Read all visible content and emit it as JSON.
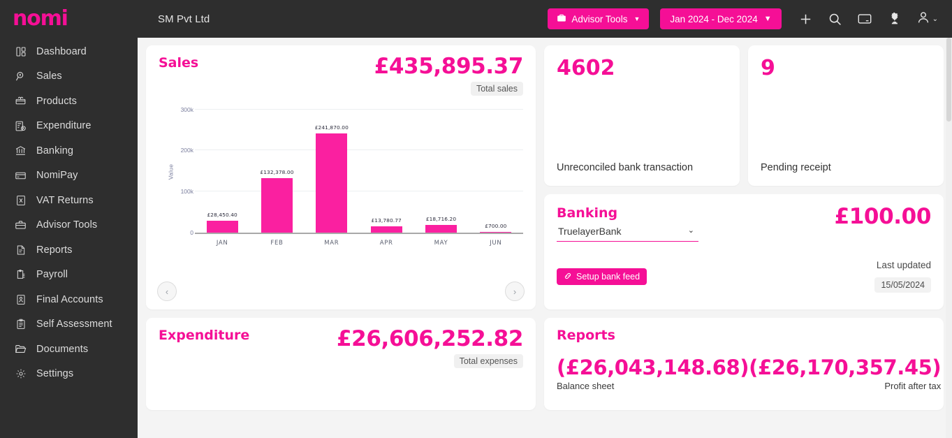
{
  "brand": {
    "logo_text": "nomi",
    "accent": "#f50f96",
    "dark": "#2e2e2e"
  },
  "header": {
    "company_name": "SM Pvt Ltd",
    "advisor_tools_label": "Advisor Tools",
    "date_range_label": "Jan 2024 - Dec 2024",
    "icons": [
      "plus-icon",
      "search-icon",
      "card-icon",
      "hmrc-crest-icon",
      "user-icon"
    ]
  },
  "sidebar": {
    "items": [
      {
        "label": "Dashboard",
        "icon": "dashboard-icon"
      },
      {
        "label": "Sales",
        "icon": "sales-icon"
      },
      {
        "label": "Products",
        "icon": "products-icon"
      },
      {
        "label": "Expenditure",
        "icon": "expenditure-icon"
      },
      {
        "label": "Banking",
        "icon": "bank-icon"
      },
      {
        "label": "NomiPay",
        "icon": "card-icon"
      },
      {
        "label": "VAT Returns",
        "icon": "vat-icon"
      },
      {
        "label": "Advisor Tools",
        "icon": "briefcase-icon"
      },
      {
        "label": "Reports",
        "icon": "report-icon"
      },
      {
        "label": "Payroll",
        "icon": "payroll-icon"
      },
      {
        "label": "Final Accounts",
        "icon": "final-accounts-icon"
      },
      {
        "label": "Self Assessment",
        "icon": "clipboard-icon"
      },
      {
        "label": "Documents",
        "icon": "folder-icon"
      },
      {
        "label": "Settings",
        "icon": "gear-icon"
      }
    ]
  },
  "sales_card": {
    "title": "Sales",
    "total": "£435,895.37",
    "total_caption": "Total sales",
    "prev_label": "‹",
    "next_label": "›"
  },
  "chart_data": {
    "type": "bar",
    "title": "Sales",
    "xlabel": "",
    "ylabel": "Value",
    "categories": [
      "JAN",
      "FEB",
      "MAR",
      "APR",
      "MAY",
      "JUN"
    ],
    "values": [
      28450.4,
      132378.0,
      241870.0,
      13780.77,
      18716.2,
      700.0
    ],
    "data_labels": [
      "£28,450.40",
      "£132,378.00",
      "£241,870.00",
      "£13,780.77",
      "£18,716.20",
      "£700.00"
    ],
    "ylim": [
      0,
      300000
    ],
    "yticks": [
      0,
      100000,
      200000,
      300000
    ],
    "ytick_labels": [
      "0",
      "100k",
      "200k",
      "300k"
    ],
    "grid": true,
    "legend": "none",
    "bar_color": "#fa20a0"
  },
  "unreconciled_card": {
    "value": "4602",
    "label": "Unreconciled bank transaction"
  },
  "pending_card": {
    "value": "9",
    "label": "Pending receipt"
  },
  "banking_card": {
    "title": "Banking",
    "amount": "£100.00",
    "selected_bank": "TruelayerBank",
    "bank_options": [
      "TruelayerBank"
    ],
    "setup_label": "Setup bank feed",
    "last_updated_label": "Last updated",
    "last_updated_date": "15/05/2024"
  },
  "expenditure_card": {
    "title": "Expenditure",
    "total": "£26,606,252.82",
    "total_caption": "Total expenses"
  },
  "reports_card": {
    "title": "Reports",
    "balance_sheet_value": "(£26,043,148.68)",
    "balance_sheet_label": "Balance sheet",
    "profit_after_tax_value": "(£26,170,357.45)",
    "profit_after_tax_label": "Profit after tax"
  }
}
